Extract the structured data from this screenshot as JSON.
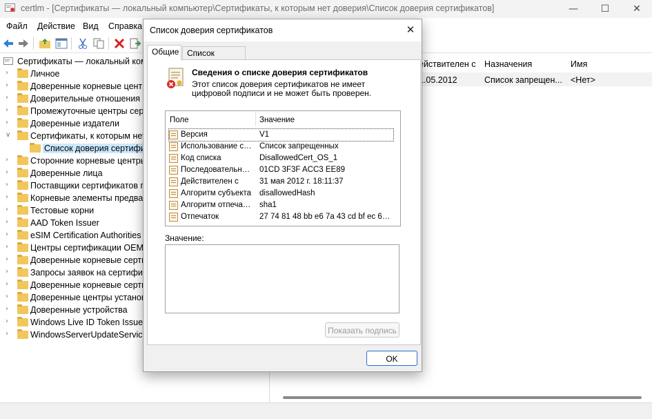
{
  "window": {
    "title": "certlm - [Сертификаты — локальный компьютер\\Сертификаты, к которым нет доверия\\Список доверия сертификатов]",
    "minimize": "—",
    "maximize": "☐",
    "close": "✕"
  },
  "menu": [
    "Файл",
    "Действие",
    "Вид",
    "Справка"
  ],
  "tree": {
    "root": "Сертификаты — локальный комп",
    "items": [
      "Личное",
      "Доверенные корневые центры",
      "Доверительные отношения в",
      "Промежуточные центры серт",
      "Доверенные издатели",
      "Сертификаты, к которым нет",
      "Список доверия сертифик",
      "Сторонние корневые центры",
      "Доверенные лица",
      "Поставщики сертификатов пр",
      "Корневые элементы предвар",
      "Тестовые корни",
      "AAD Token Issuer",
      "eSIM Certification Authorities",
      "Центры сертификации OEM е",
      "Доверенные корневые сертис",
      "Запросы заявок на сертифика",
      "Доверенные корневые сертис",
      "Доверенные центры установк",
      "Доверенные устройства",
      "Windows Live ID Token Issuer",
      "WindowsServerUpdateServices"
    ]
  },
  "list": {
    "columns": [
      "ействителен с",
      "Назначения",
      "Имя"
    ],
    "row": [
      "1.05.2012",
      "Список запрещен...",
      "<Нет>"
    ]
  },
  "dialog": {
    "title": "Список доверия сертификатов",
    "close": "✕",
    "tabs": [
      "Общие",
      "Список доверия"
    ],
    "heading": "Сведения о списке доверия сертификатов",
    "description": "Этот список доверия сертификатов не имеет цифровой подписи и не может быть проверен.",
    "table": {
      "headers": [
        "Поле",
        "Значение"
      ],
      "rows": [
        {
          "field": "Версия",
          "value": "V1"
        },
        {
          "field": "Использование су...",
          "value": "Список запрещенных"
        },
        {
          "field": "Код списка",
          "value": "DisallowedCert_OS_1"
        },
        {
          "field": "Последовательны...",
          "value": "01CD 3F3F ACC3 EE89"
        },
        {
          "field": "Действителен с",
          "value": "31 мая 2012 г. 18:11:37"
        },
        {
          "field": "Алгоритм субъекта",
          "value": "disallowedHash"
        },
        {
          "field": "Алгоритм отпечатка",
          "value": "sha1"
        },
        {
          "field": "Отпечаток",
          "value": "27 74 81 48 bb e6 7a 43 cd bf ec 6c ..."
        }
      ]
    },
    "value_label": "Значение:",
    "show_signature": "Показать подпись",
    "ok": "OK"
  }
}
